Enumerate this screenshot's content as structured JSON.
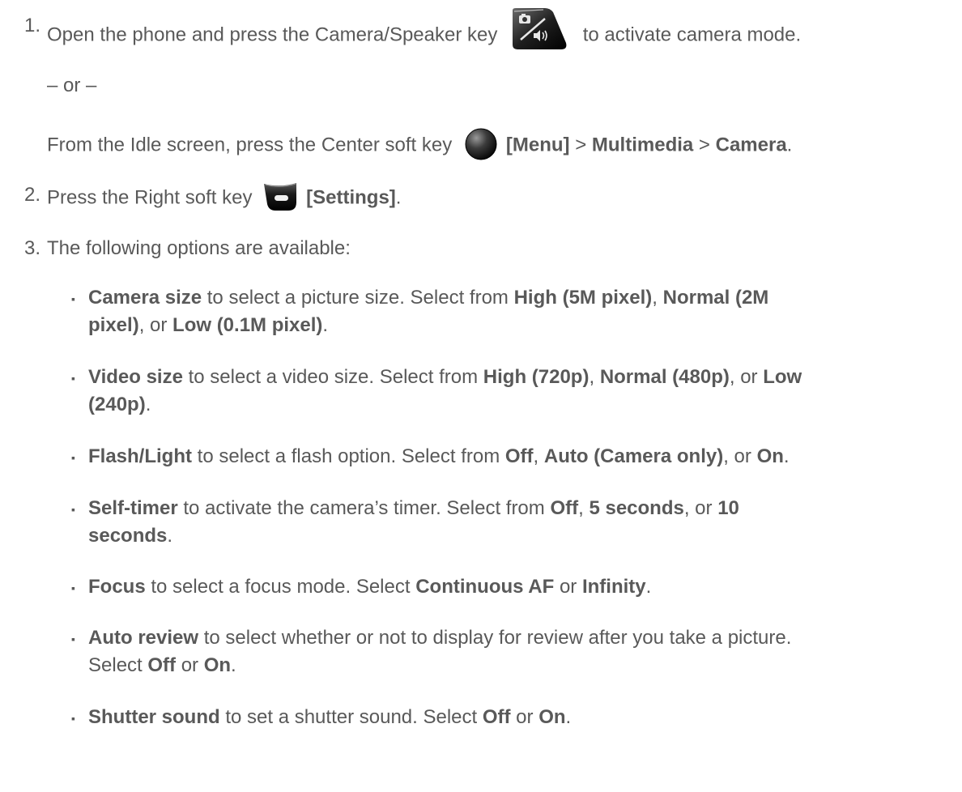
{
  "step1": {
    "number": "1.",
    "text_before_icon": "Open the phone and press the Camera/Speaker key",
    "icon": "camera-speaker-key-icon",
    "text_after_icon": "to activate camera mode.",
    "or": "– or –",
    "alt_before_icon": "From the Idle screen, press the Center soft key",
    "alt_icon": "center-soft-key-icon",
    "menu_label": "[Menu]",
    "sep1": " > ",
    "multimedia_label": "Multimedia",
    "sep2": " > ",
    "camera_label": "Camera",
    "end": "."
  },
  "step2": {
    "number": "2.",
    "text_before_icon": "Press the Right soft key",
    "icon": "right-soft-key-icon",
    "settings_label": "[Settings]",
    "end": "."
  },
  "step3": {
    "number": "3.",
    "text": "The following options are available:"
  },
  "options": [
    {
      "name": "Camera size",
      "line1_desc": " to select a picture size. Select from ",
      "line1_b1": "High (5M pixel)",
      "line1_sep": ", ",
      "line1_b2": "Normal (2M",
      "line2_b2": "pixel)",
      "line2_sep": ", or ",
      "line2_b3": "Low (0.1M pixel)",
      "line2_end": "."
    },
    {
      "name": "Video size",
      "line1_desc": " to select a video size. Select from ",
      "line1_b1": "High (720p)",
      "line1_sep": ", ",
      "line1_b2": "Normal (480p)",
      "line1_sep2": ", or ",
      "line1_b3": "Low",
      "line2_b3": "(240p)",
      "line2_end": "."
    },
    {
      "name": "Flash/Light",
      "line1_desc": " to select a flash option. Select from ",
      "line1_b1": "Off",
      "line1_sep": ", ",
      "line1_b2": "Auto (Camera only)",
      "line1_sep2": ", or ",
      "line1_b3": "On",
      "line1_end": "."
    },
    {
      "name": "Self-timer",
      "line1_desc": " to activate the camera’s timer. Select from ",
      "line1_b1": "Off",
      "line1_sep": ", ",
      "line1_b2": "5 seconds",
      "line1_sep2": ", or ",
      "line1_b3": "10",
      "line2_b3": "seconds",
      "line2_end": "."
    },
    {
      "name": "Focus",
      "line1_desc": " to select a focus mode. Select ",
      "line1_b1": "Continuous AF",
      "line1_sep": " or ",
      "line1_b2": "Infinity",
      "line1_end": "."
    },
    {
      "name": "Auto review",
      "line1_desc": " to select whether or not to display for review after you take a picture.",
      "line2_pre": "Select ",
      "line2_b1": "Off",
      "line2_sep": " or ",
      "line2_b2": "On",
      "line2_end": "."
    },
    {
      "name": "Shutter sound",
      "line1_desc": " to set a shutter sound. Select ",
      "line1_b1": "Off",
      "line1_sep": " or ",
      "line1_b2": "On",
      "line1_end": "."
    }
  ],
  "bullet_char": "▪"
}
